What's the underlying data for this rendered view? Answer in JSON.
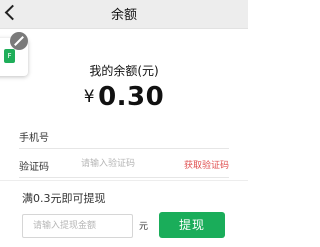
{
  "header": {
    "title": "余额"
  },
  "float_card": {
    "icon_letter": "F"
  },
  "balance": {
    "label": "我的余额(元)",
    "currency_symbol": "¥",
    "amount": "0.30"
  },
  "form": {
    "phone_label": "手机号",
    "phone_value": "",
    "code_label": "验证码",
    "code_placeholder": "请输入验证码",
    "get_code_label": "获取验证码"
  },
  "withdraw": {
    "min_text": "满0.3元即可提现",
    "amount_placeholder": "请输入提现金额",
    "unit": "元",
    "button_label": "提现"
  },
  "colors": {
    "accent_green": "#1aad5a",
    "link_red": "#e05050"
  }
}
